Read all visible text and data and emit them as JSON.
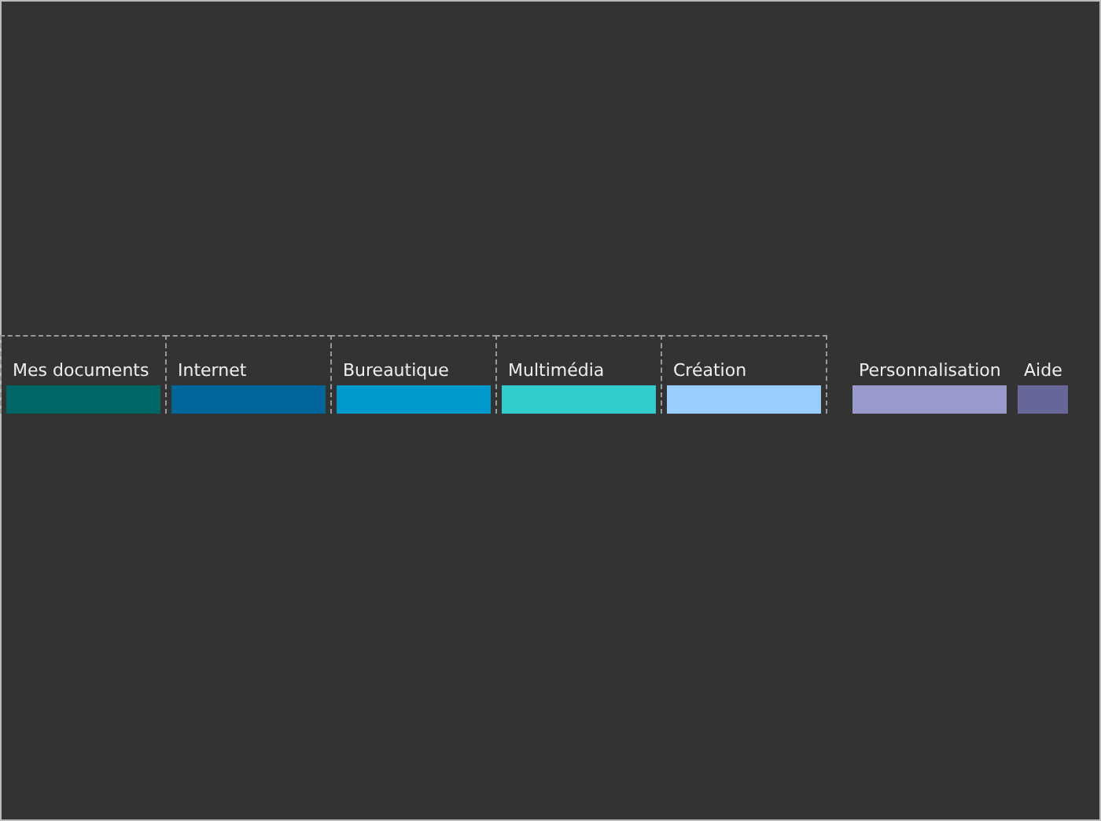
{
  "menu": [
    {
      "label": "Mes documents",
      "color": "#006666",
      "outlined": true
    },
    {
      "label": "Internet",
      "color": "#006699",
      "outlined": true
    },
    {
      "label": "Bureautique",
      "color": "#0099cc",
      "outlined": true
    },
    {
      "label": "Multimédia",
      "color": "#33cccc",
      "outlined": true
    },
    {
      "label": "Création",
      "color": "#99ccff",
      "outlined": true
    },
    {
      "label": "Personnalisation",
      "color": "#9999cc",
      "outlined": false
    },
    {
      "label": "Aide",
      "color": "#666699",
      "outlined": false
    }
  ]
}
